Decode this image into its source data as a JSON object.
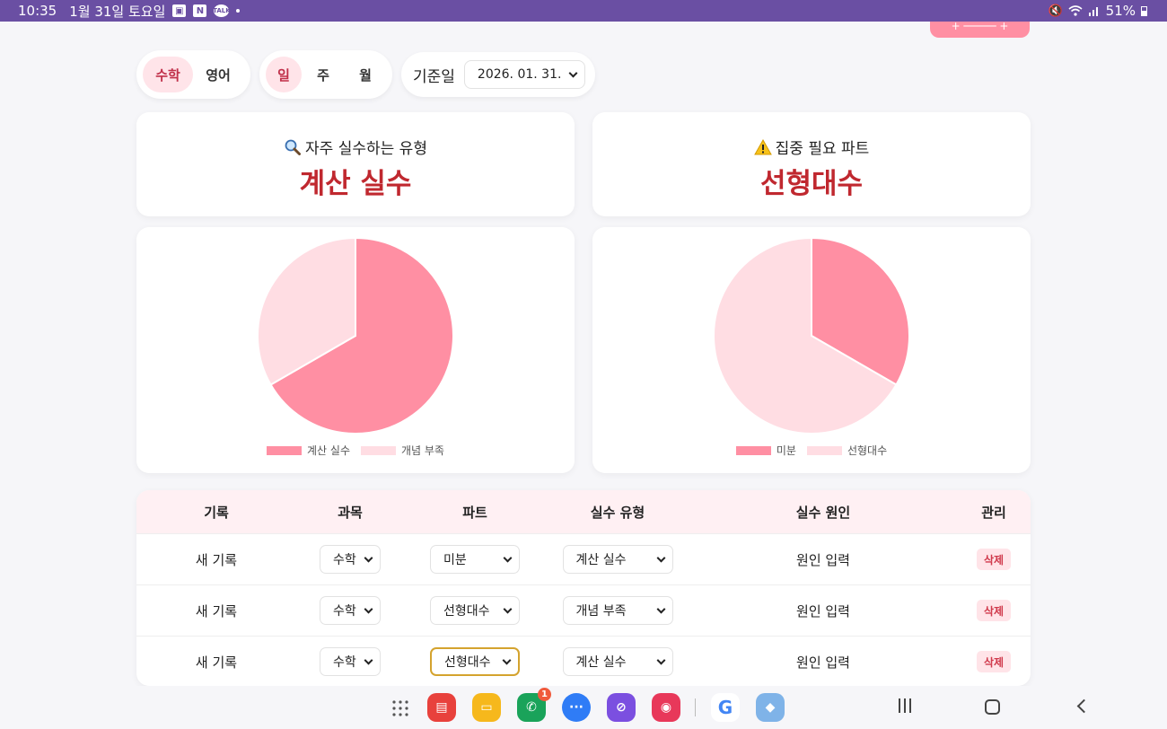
{
  "status_bar": {
    "time": "10:35",
    "date": "1월 31일 토요일",
    "notification_icons": [
      "gallery-icon",
      "naver-icon",
      "kakaotalk-icon"
    ],
    "battery": "51%"
  },
  "filters": {
    "subjects": [
      {
        "label": "수학",
        "active": true
      },
      {
        "label": "영어",
        "active": false
      }
    ],
    "periods": [
      {
        "label": "일",
        "active": true
      },
      {
        "label": "주",
        "active": false
      },
      {
        "label": "월",
        "active": false
      }
    ],
    "date_label": "기준일",
    "date_value": "2026. 01. 31."
  },
  "summary": {
    "frequent_mistake": {
      "title": "자주 실수하는 유형",
      "value": "계산 실수",
      "icon": "magnifier-icon"
    },
    "focus_part": {
      "title": "집중 필요 파트",
      "value": "선형대수",
      "icon": "warning-icon"
    }
  },
  "chart_data": [
    {
      "type": "pie",
      "categories": [
        "계산 실수",
        "개념 부족"
      ],
      "values": [
        2,
        1
      ],
      "colors": [
        "#ff8fa3",
        "#ffdde3"
      ]
    },
    {
      "type": "pie",
      "categories": [
        "미분",
        "선형대수"
      ],
      "values": [
        1,
        2
      ],
      "colors": [
        "#ff8fa3",
        "#ffdde3"
      ]
    }
  ],
  "table": {
    "headers": [
      "기록",
      "과목",
      "파트",
      "실수 유형",
      "실수 원인",
      "관리"
    ],
    "rows": [
      {
        "record": "새 기록",
        "subject": "수학",
        "part": "미분",
        "type": "계산 실수",
        "cause": "원인 입력",
        "action": "삭제"
      },
      {
        "record": "새 기록",
        "subject": "수학",
        "part": "선형대수",
        "type": "개념 부족",
        "cause": "원인 입력",
        "action": "삭제"
      },
      {
        "record": "새 기록",
        "subject": "수학",
        "part": "선형대수",
        "type": "계산 실수",
        "cause": "원인 입력",
        "action": "삭제"
      }
    ]
  },
  "nav": {
    "apps": [
      "app-drawer-icon",
      "flexcil-icon",
      "files-icon",
      "phone-icon",
      "messages-icon",
      "browser-icon",
      "camera-icon",
      "google-icon",
      "game-icon"
    ],
    "phone_badge": "1"
  }
}
